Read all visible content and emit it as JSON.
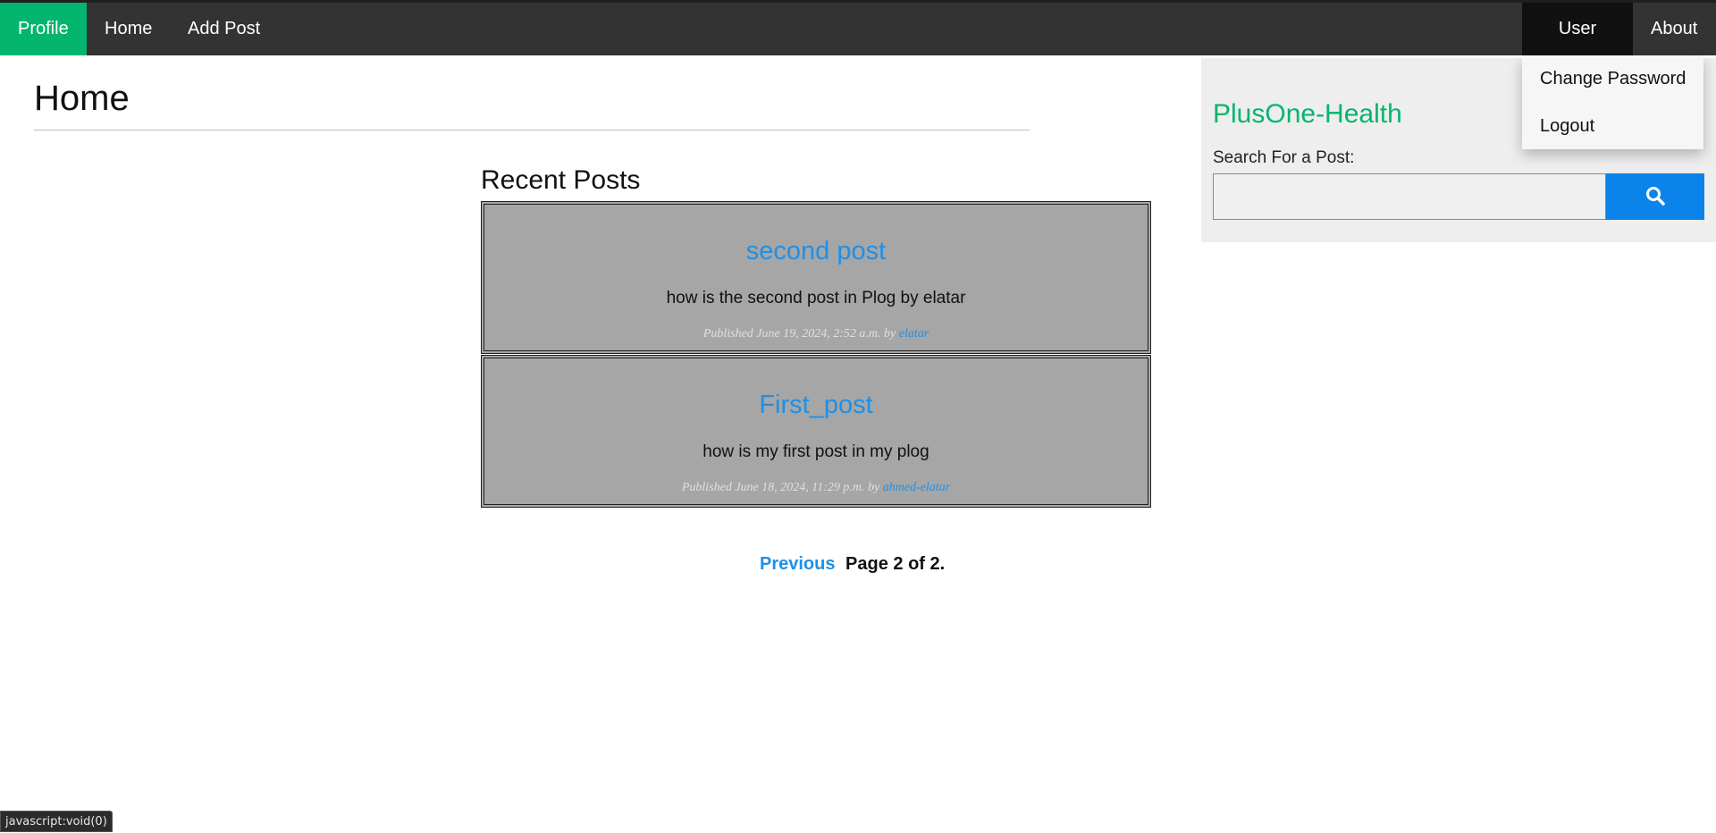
{
  "nav": {
    "left": [
      "Profile",
      "Home",
      "Add Post"
    ],
    "user": "User",
    "about": "About"
  },
  "user_menu": {
    "items": [
      "Change Password",
      "Logout"
    ]
  },
  "main": {
    "title": "Home",
    "section_title": "Recent Posts",
    "posts": [
      {
        "title": "second post",
        "body": "how is the second post in Plog by elatar",
        "meta_prefix": "Published June 19, 2024, 2:52 a.m. by",
        "author": "elatar"
      },
      {
        "title": "First_post",
        "body": "how is my first post in my plog",
        "meta_prefix": "Published June 18, 2024, 11:29 p.m. by",
        "author": "ahmed-elatar"
      }
    ],
    "pagination": {
      "previous": "Previous",
      "status": "Page 2 of 2."
    }
  },
  "sidebar": {
    "brand": "PlusOne-Health",
    "search_label": "Search For a Post:",
    "search_value": "",
    "search_icon": "search-icon"
  },
  "status_bar": "javascript:void(0)",
  "colors": {
    "topbar": "#333333",
    "active_nav": "#04b56f",
    "user_nav": "#111111",
    "link": "#1e90e8",
    "post_bg": "#a6a6a6",
    "brand": "#04b56f",
    "search_button": "#0a84ea"
  }
}
